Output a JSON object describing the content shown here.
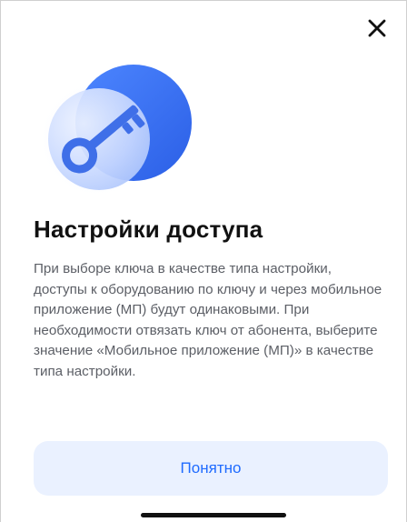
{
  "dialog": {
    "title": "Настройки доступа",
    "description": "При выборе ключа в качестве типа настройки, доступы к оборудованию по ключу и через мобильное приложение (МП) будут одинаковыми. При необходимости отвязать ключ от абонента, выберите значение «Мобильное приложение (МП)» в качестве типа настройки.",
    "confirm_label": "Понятно",
    "close_icon": "close-icon",
    "hero_icon": "key-icon"
  },
  "colors": {
    "accent": "#1f6bff",
    "button_bg": "#eaf1ff",
    "title": "#111111",
    "text": "#5c5f66",
    "hero_blue": "#3d73f2",
    "hero_light": "#dbe6ff"
  }
}
